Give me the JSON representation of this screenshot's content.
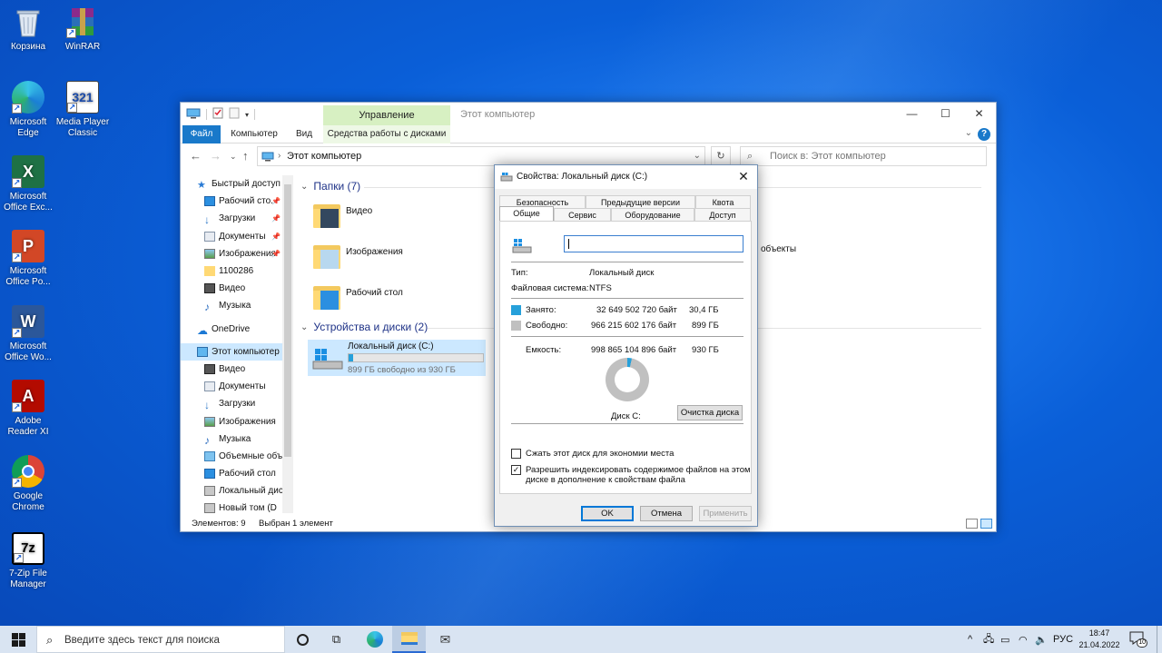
{
  "desktop": {
    "icons": [
      {
        "label": "Корзина"
      },
      {
        "label": "WinRAR"
      },
      {
        "label": "Microsoft Edge"
      },
      {
        "label": "Media Player Classic"
      },
      {
        "label": "Microsoft Office Exc..."
      },
      {
        "label": "Microsoft Office Po..."
      },
      {
        "label": "Microsoft Office Wo..."
      },
      {
        "label": "Adobe Reader XI"
      },
      {
        "label": "Google Chrome"
      },
      {
        "label": "7-Zip File Manager"
      }
    ]
  },
  "explorer": {
    "title": "Этот компьютер",
    "context_tab_header": "Управление",
    "tabs": [
      "Файл",
      "Компьютер",
      "Вид",
      "Средства работы с дисками"
    ],
    "address": "Этот компьютер",
    "address_sep": "›",
    "search_placeholder": "Поиск в: Этот компьютер",
    "nav_items": [
      "Быстрый доступ",
      "Рабочий сто.",
      "Загрузки",
      "Документы",
      "Изображения",
      "1100286",
      "Видео",
      "Музыка",
      "OneDrive",
      "Этот компьютер",
      "Видео",
      "Документы",
      "Загрузки",
      "Изображения",
      "Музыка",
      "Объемные объ",
      "Рабочий стол",
      "Локальный дис",
      "Новый том (D"
    ],
    "folders_group": "Папки (7)",
    "folders": [
      "Видео",
      "Изображения",
      "Рабочий стол"
    ],
    "partial_folder_text": "объекты",
    "devices_group": "Устройства и диски (2)",
    "drive": {
      "name": "Локальный диск (C:)",
      "free_text": "899 ГБ свободно из 930 ГБ",
      "used_fraction": 0.033
    },
    "status": {
      "items": "Элементов: 9",
      "selected": "Выбран 1 элемент"
    }
  },
  "dialog": {
    "title": "Свойства: Локальный диск (C:)",
    "tabs_row1": [
      "Безопасность",
      "Предыдущие версии",
      "Квота"
    ],
    "tabs_row2": [
      "Общие",
      "Сервис",
      "Оборудование",
      "Доступ"
    ],
    "name_value": "",
    "type_label": "Тип:",
    "type_value": "Локальный диск",
    "fs_label": "Файловая система:",
    "fs_value": "NTFS",
    "used": {
      "label": "Занято:",
      "bytes": "32 649 502 720 байт",
      "size": "30,4 ГБ",
      "color": "#26a0da"
    },
    "free": {
      "label": "Свободно:",
      "bytes": "966 215 602 176 байт",
      "size": "899 ГБ",
      "color": "#c0c0c0"
    },
    "capacity": {
      "label": "Емкость:",
      "bytes": "998 865 104 896 байт",
      "size": "930 ГБ"
    },
    "used_fraction": 0.033,
    "disk_label": "Диск C:",
    "cleanup_button": "Очистка диска",
    "compress_checkbox": {
      "label": "Сжать этот диск для экономии места",
      "checked": false
    },
    "index_checkbox": {
      "label_line1": "Разрешить индексировать содержимое файлов на этом",
      "label_line2": "диске в дополнение к свойствам файла",
      "checked": true
    },
    "ok_button": "OK",
    "cancel_button": "Отмена",
    "apply_button": "Применить"
  },
  "taskbar": {
    "search_placeholder": "Введите здесь текст для поиска",
    "language": "РУС",
    "time": "18:47",
    "date": "21.04.2022",
    "notification_count": "10"
  }
}
